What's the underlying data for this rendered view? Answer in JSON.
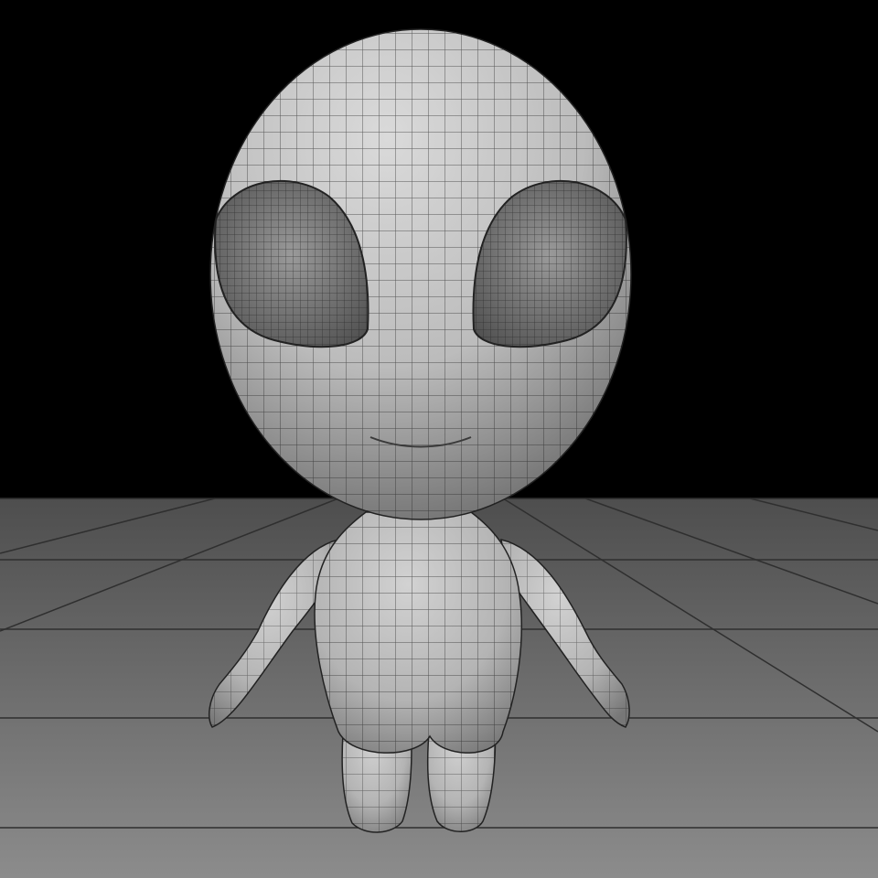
{
  "scene": {
    "subject_icon": "alien-character-icon",
    "colors": {
      "background": "#000000",
      "floor_near": "#8a8a8a",
      "floor_far": "#5a5a5a",
      "floor_grid": "#3a3a3a",
      "mesh_surface": "#c8c8c8",
      "mesh_shadow": "#6e6e6e",
      "wireframe": "#1e1e1e"
    }
  }
}
